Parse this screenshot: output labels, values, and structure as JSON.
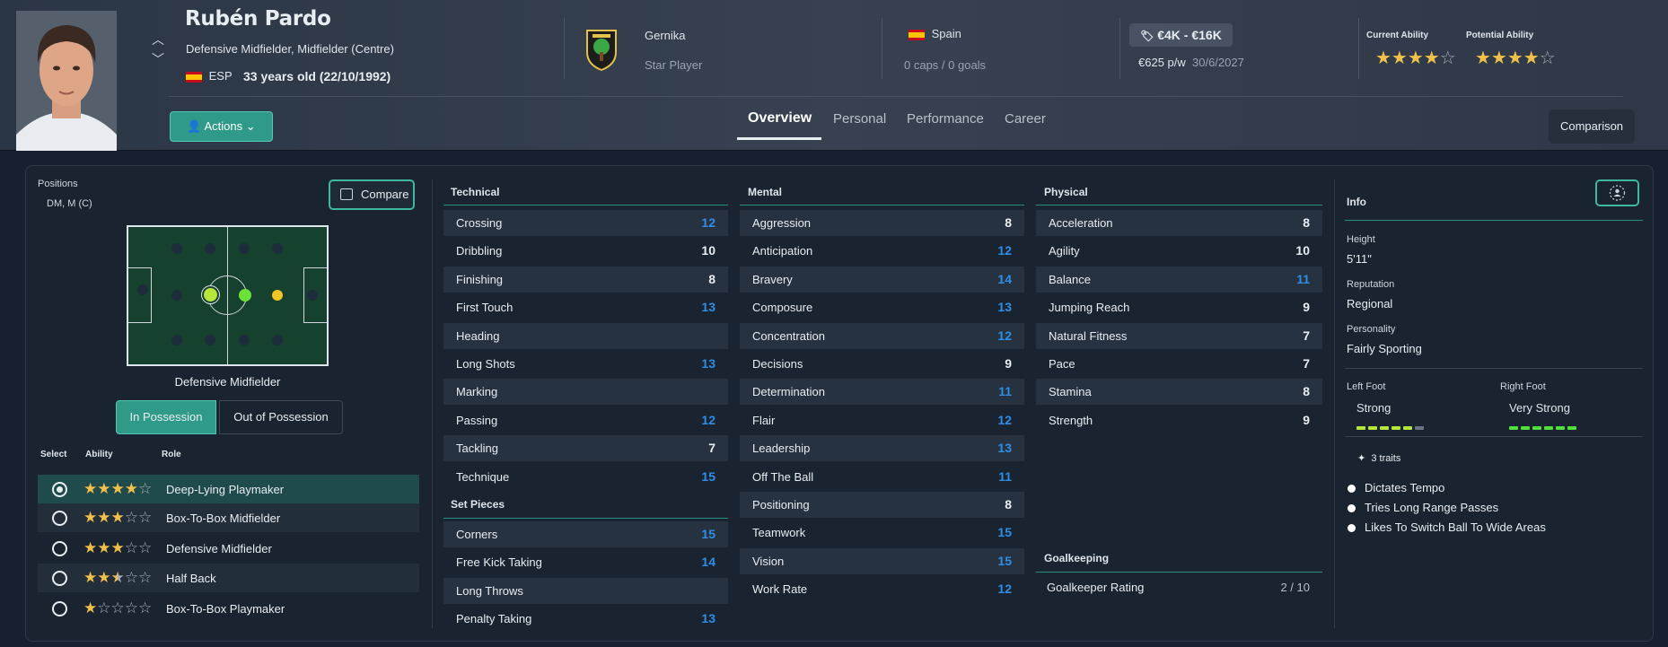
{
  "header": {
    "name": "Rubén Pardo",
    "positions": "Defensive Midfielder, Midfielder (Centre)",
    "nationality_code": "ESP",
    "age": "33 years old (22/10/1992)",
    "club": "Gernika",
    "squad_status": "Star Player",
    "nation": "Spain",
    "caps": "0 caps / 0 goals",
    "value": "€4K - €16K",
    "wage": "€625 p/w",
    "contract_end": "30/6/2027",
    "current_ability_label": "Current Ability",
    "current_ability_stars": 4,
    "potential_ability_label": "Potential Ability",
    "potential_ability_stars": 4,
    "actions_label": "Actions",
    "comparison_label": "Comparison",
    "tabs": [
      "Overview",
      "Personal",
      "Performance",
      "Career"
    ],
    "active_tab": "Overview"
  },
  "left": {
    "positions_label": "Positions",
    "positions_value": "DM, M (C)",
    "compare_label": "Compare",
    "pitch_position": "Defensive Midfielder",
    "in_possession": "In Possession",
    "out_possession": "Out of Possession",
    "headers": {
      "select": "Select",
      "ability": "Ability",
      "role": "Role"
    },
    "roles": [
      {
        "name": "Deep-Lying Playmaker",
        "stars": 4,
        "selected": true
      },
      {
        "name": "Box-To-Box Midfielder",
        "stars": 3,
        "selected": false
      },
      {
        "name": "Defensive Midfielder",
        "stars": 3,
        "selected": false
      },
      {
        "name": "Half Back",
        "stars": 2.5,
        "selected": false
      },
      {
        "name": "Box-To-Box Playmaker",
        "stars": 1,
        "selected": false
      }
    ]
  },
  "technical": {
    "title": "Technical",
    "items": [
      {
        "name": "Crossing",
        "value": "12"
      },
      {
        "name": "Dribbling",
        "value": "10"
      },
      {
        "name": "Finishing",
        "value": "8"
      },
      {
        "name": "First Touch",
        "value": "13"
      },
      {
        "name": "Heading",
        "value": ""
      },
      {
        "name": "Long Shots",
        "value": "13"
      },
      {
        "name": "Marking",
        "value": ""
      },
      {
        "name": "Passing",
        "value": "12"
      },
      {
        "name": "Tackling",
        "value": "7"
      },
      {
        "name": "Technique",
        "value": "15"
      }
    ]
  },
  "set_pieces": {
    "title": "Set Pieces",
    "items": [
      {
        "name": "Corners",
        "value": "15"
      },
      {
        "name": "Free Kick Taking",
        "value": "14"
      },
      {
        "name": "Long Throws",
        "value": ""
      },
      {
        "name": "Penalty Taking",
        "value": "13"
      }
    ]
  },
  "mental": {
    "title": "Mental",
    "items": [
      {
        "name": "Aggression",
        "value": "8"
      },
      {
        "name": "Anticipation",
        "value": "12"
      },
      {
        "name": "Bravery",
        "value": "14"
      },
      {
        "name": "Composure",
        "value": "13"
      },
      {
        "name": "Concentration",
        "value": "12"
      },
      {
        "name": "Decisions",
        "value": "9"
      },
      {
        "name": "Determination",
        "value": "11"
      },
      {
        "name": "Flair",
        "value": "12"
      },
      {
        "name": "Leadership",
        "value": "13"
      },
      {
        "name": "Off The Ball",
        "value": "11"
      },
      {
        "name": "Positioning",
        "value": "8"
      },
      {
        "name": "Teamwork",
        "value": "15"
      },
      {
        "name": "Vision",
        "value": "15"
      },
      {
        "name": "Work Rate",
        "value": "12"
      }
    ]
  },
  "physical": {
    "title": "Physical",
    "items": [
      {
        "name": "Acceleration",
        "value": "8"
      },
      {
        "name": "Agility",
        "value": "10"
      },
      {
        "name": "Balance",
        "value": "11"
      },
      {
        "name": "Jumping Reach",
        "value": "9"
      },
      {
        "name": "Natural Fitness",
        "value": "7"
      },
      {
        "name": "Pace",
        "value": "7"
      },
      {
        "name": "Stamina",
        "value": "8"
      },
      {
        "name": "Strength",
        "value": "9"
      }
    ]
  },
  "goalkeeping": {
    "title": "Goalkeeping",
    "rating_label": "Goalkeeper Rating",
    "rating_value": "2 / 10"
  },
  "info": {
    "title": "Info",
    "height_label": "Height",
    "height_value": "5'11\"",
    "reputation_label": "Reputation",
    "reputation_value": "Regional",
    "personality_label": "Personality",
    "personality_value": "Fairly Sporting",
    "left_foot_label": "Left Foot",
    "left_foot_value": "Strong",
    "left_foot_level": 5,
    "right_foot_label": "Right Foot",
    "right_foot_value": "Very Strong",
    "right_foot_level": 6,
    "traits_label": "3 traits",
    "traits": [
      "Dictates Tempo",
      "Tries Long Range Passes",
      "Likes To Switch Ball To Wide Areas"
    ]
  },
  "colors": {
    "accent": "#2f9a88",
    "attr_blue": "#2f8ee6",
    "star": "#f1c04b"
  }
}
